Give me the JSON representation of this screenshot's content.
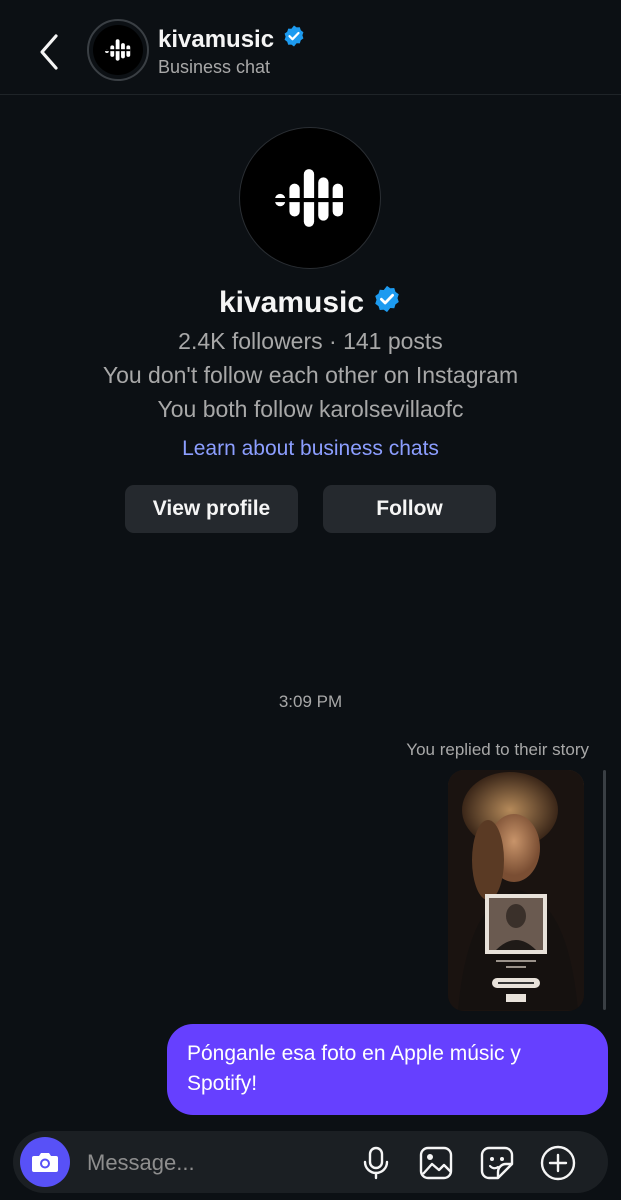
{
  "header": {
    "title": "kivamusic",
    "subtitle": "Business chat"
  },
  "profile": {
    "name": "kivamusic",
    "stats": "2.4K followers · 141 posts",
    "follow_status": "You don't follow each other on Instagram",
    "mutual": "You both follow karolsevillaofc",
    "learn_link": "Learn about business chats",
    "view_profile_label": "View profile",
    "follow_label": "Follow"
  },
  "chat": {
    "timestamp": "3:09 PM",
    "replied_label": "You replied to their story",
    "message": "Pónganle esa foto en Apple músic y Spotify!"
  },
  "composer": {
    "placeholder": "Message..."
  },
  "colors": {
    "accent_bubble": "#6640ff",
    "link": "#8c9eff",
    "verified": "#1d9bf0",
    "camera_button": "#5851f7"
  }
}
